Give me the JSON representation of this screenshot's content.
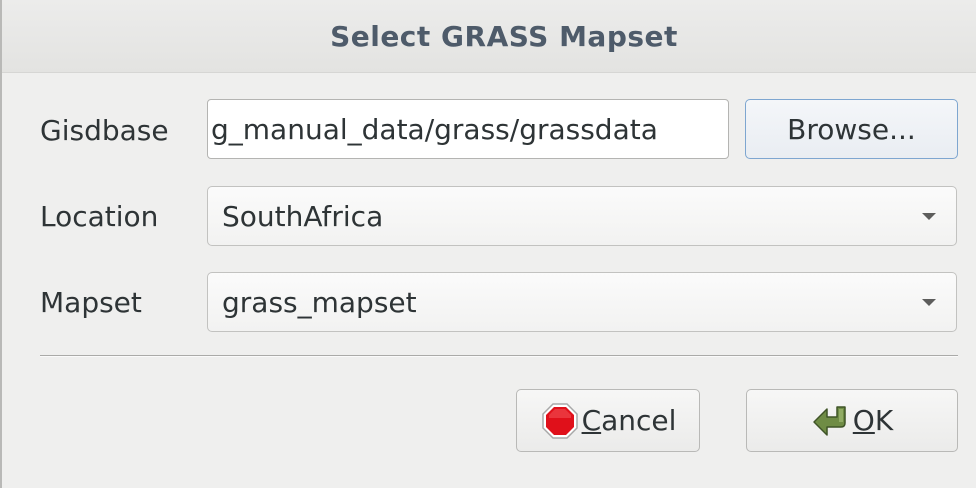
{
  "dialog": {
    "title": "Select GRASS Mapset"
  },
  "form": {
    "gisdbase": {
      "label": "Gisdbase",
      "value": "g_manual_data/grass/grassdata"
    },
    "browse_label": "Browse...",
    "location": {
      "label": "Location",
      "selected": "SouthAfrica"
    },
    "mapset": {
      "label": "Mapset",
      "selected": "grass_mapset"
    }
  },
  "buttons": {
    "cancel_label": "Cancel",
    "ok_label": "OK",
    "cancel_icon": "stop-icon",
    "ok_icon": "return-arrow-icon"
  },
  "colors": {
    "title_text": "#4e5b6a",
    "cancel_icon_red": "#e0101a",
    "ok_icon_green": "#6f8c45"
  }
}
